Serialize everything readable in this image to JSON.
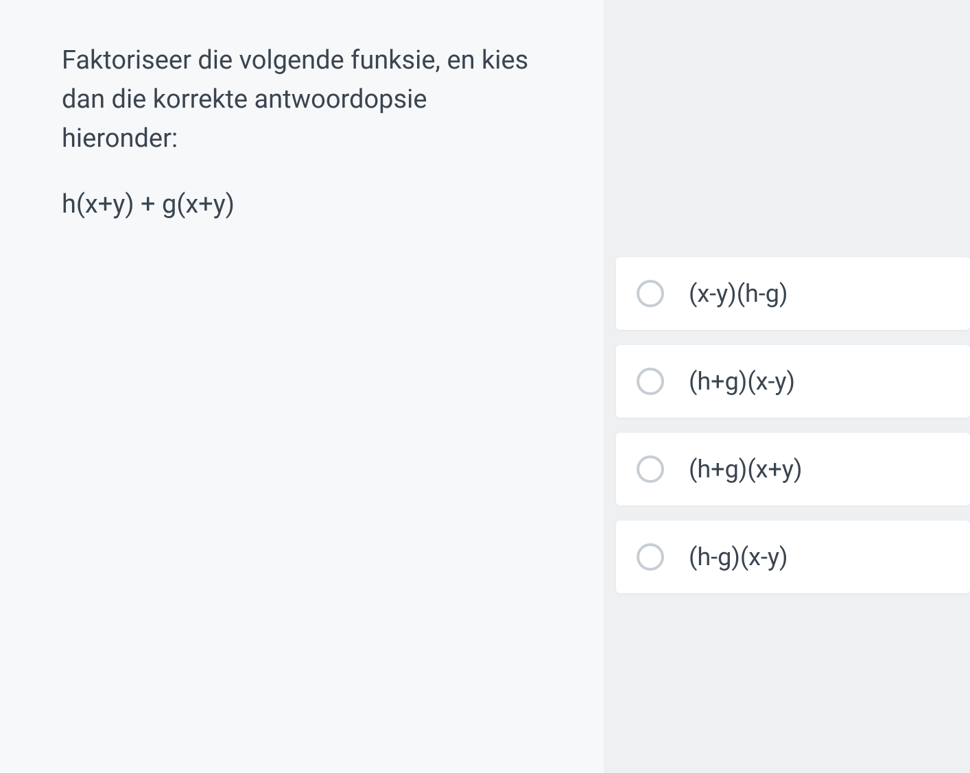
{
  "question": {
    "prompt": "Faktoriseer die volgende funksie, en kies dan die korrekte antwoordopsie hieronder:",
    "expression": "h(x+y) + g(x+y)"
  },
  "options": [
    {
      "label": "(x-y)(h-g)"
    },
    {
      "label": "(h+g)(x-y)"
    },
    {
      "label": "(h+g)(x+y)"
    },
    {
      "label": "(h-g)(x-y)"
    }
  ]
}
